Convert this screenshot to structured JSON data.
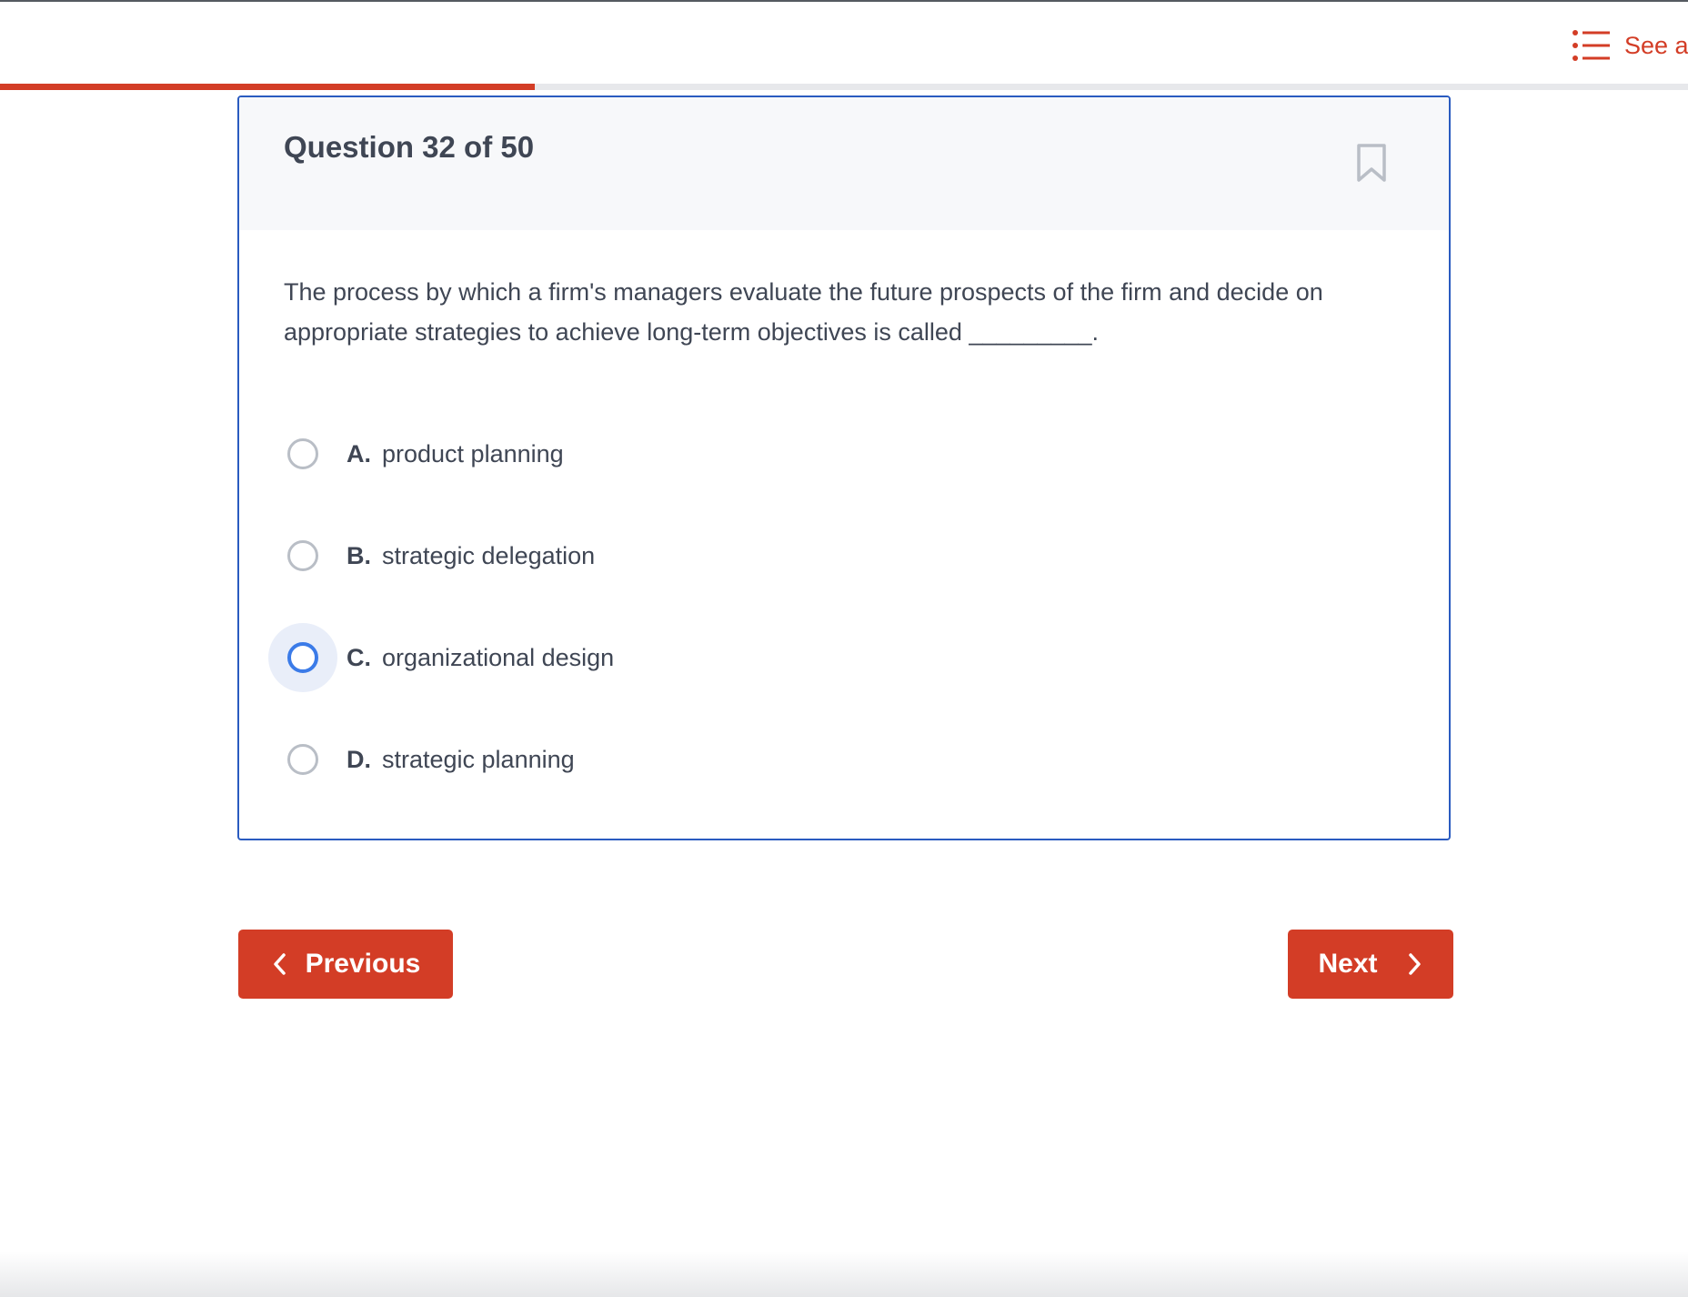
{
  "header": {
    "see_all_label": "See a",
    "see_all_icon": "list-icon",
    "accent_color": "#d33d26"
  },
  "progress": {
    "fraction": 0.317
  },
  "question": {
    "title": "Question 32 of 50",
    "bookmark_icon": "bookmark-icon",
    "text": "The process by which a firm's managers evaluate the future prospects of the firm and decide on appropriate strategies to achieve long-term objectives is called _________.",
    "options": [
      {
        "letter": "A.",
        "text": "product planning",
        "focused": false
      },
      {
        "letter": "B.",
        "text": "strategic delegation",
        "focused": false
      },
      {
        "letter": "C.",
        "text": "organizational design",
        "focused": true
      },
      {
        "letter": "D.",
        "text": "strategic planning",
        "focused": false
      }
    ]
  },
  "navigation": {
    "previous_label": "Previous",
    "next_label": "Next",
    "previous_icon": "chevron-left-icon",
    "next_icon": "chevron-right-icon"
  }
}
